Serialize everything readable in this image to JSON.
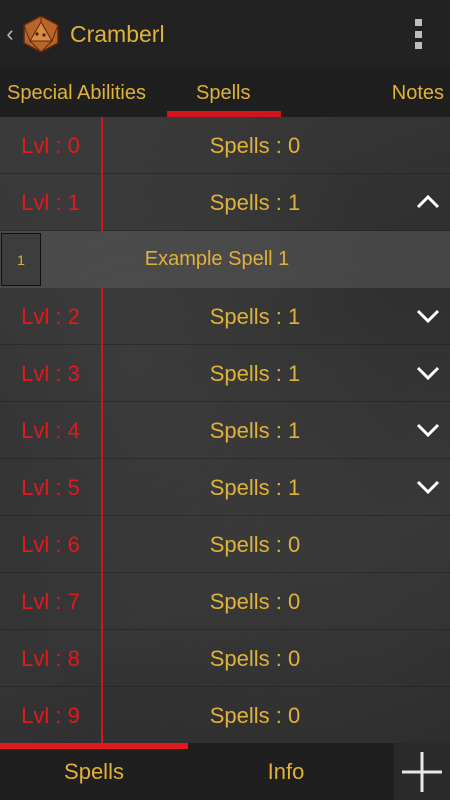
{
  "app": {
    "title": "Cramberl",
    "up_icon": "chevron-left-icon",
    "app_icon": "d20-dice-icon",
    "overflow_icon": "overflow-menu-icon"
  },
  "tabs": [
    {
      "label": "Special Abilities",
      "selected": false
    },
    {
      "label": "Spells",
      "selected": true
    },
    {
      "label": "Notes",
      "selected": false
    }
  ],
  "levels": [
    {
      "level": "Lvl : 0",
      "spells": "Spells : 0",
      "chevron": null
    },
    {
      "level": "Lvl : 1",
      "spells": "Spells : 1",
      "chevron": "chevron-up-icon",
      "expanded": true
    },
    {
      "level": "Lvl : 2",
      "spells": "Spells : 1",
      "chevron": "chevron-down-icon"
    },
    {
      "level": "Lvl : 3",
      "spells": "Spells : 1",
      "chevron": "chevron-down-icon"
    },
    {
      "level": "Lvl : 4",
      "spells": "Spells : 1",
      "chevron": "chevron-down-icon"
    },
    {
      "level": "Lvl : 5",
      "spells": "Spells : 1",
      "chevron": "chevron-down-icon"
    },
    {
      "level": "Lvl : 6",
      "spells": "Spells : 0",
      "chevron": null
    },
    {
      "level": "Lvl : 7",
      "spells": "Spells : 0",
      "chevron": null
    },
    {
      "level": "Lvl : 8",
      "spells": "Spells : 0",
      "chevron": null
    },
    {
      "level": "Lvl : 9",
      "spells": "Spells : 0",
      "chevron": null
    }
  ],
  "expanded_spell": {
    "number": "1",
    "name": "Example Spell 1"
  },
  "bottom_tabs": [
    {
      "label": "Spells",
      "selected": true
    },
    {
      "label": "Info",
      "selected": false
    }
  ],
  "add_button_icon": "plus-icon",
  "colors": {
    "accent_red": "#d3141b",
    "text_gold": "#e0b23a",
    "level_red": "#e3191e",
    "bar_bg": "#1f1f1f"
  }
}
